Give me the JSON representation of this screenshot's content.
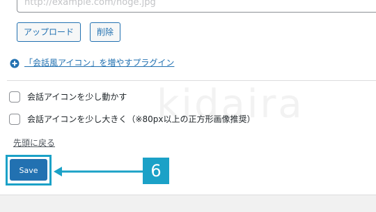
{
  "image_url_field": {
    "placeholder": "http://example.com/hoge.jpg"
  },
  "buttons": {
    "upload_label": "アップロード",
    "delete_label": "削除"
  },
  "plugin_link": {
    "icon": "plus-circle-icon",
    "label": "「会話風アイコン」を増やすプラグイン"
  },
  "options": [
    {
      "label": "会話アイコンを少し動かす",
      "checked": false
    },
    {
      "label": "会話アイコンを少し大きく（※80px以上の正方形画像推奨）",
      "checked": false
    }
  ],
  "back_to_top_label": "先頭に戻る",
  "save_button_label": "Save",
  "annotation": {
    "step_number": "6",
    "color": "#1ba1c7"
  },
  "watermark_text": "kidaira",
  "colors": {
    "accent": "#2271b1",
    "highlight": "#1ba1c7",
    "page_background": "#f1f1f1",
    "panel_background": "#ffffff"
  }
}
